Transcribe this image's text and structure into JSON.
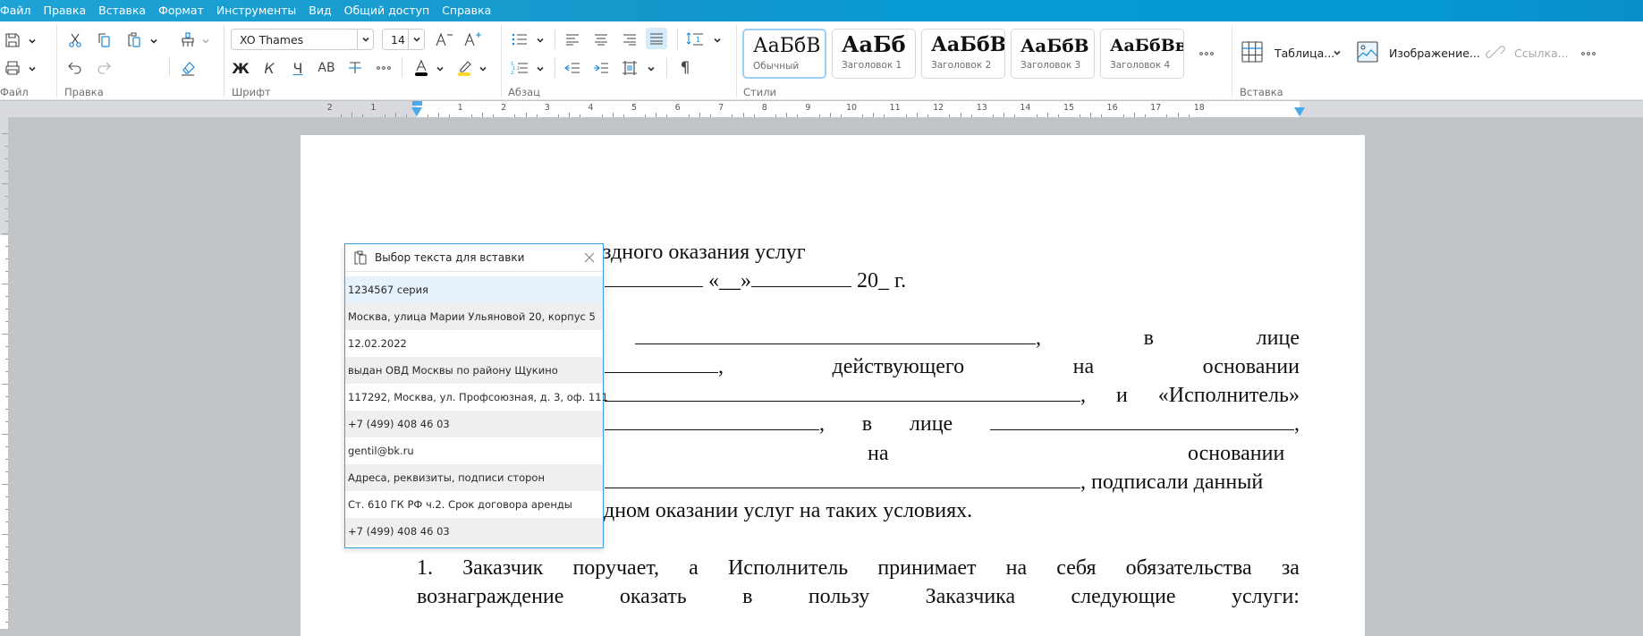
{
  "menu": [
    "Файл",
    "Правка",
    "Вставка",
    "Формат",
    "Инструменты",
    "Вид",
    "Общий доступ",
    "Справка"
  ],
  "ribbon": {
    "groups": {
      "file": "Файл",
      "edit": "Правка",
      "font": "Шрифт",
      "paragraph": "Абзац",
      "styles": "Стили",
      "insert": "Вставка"
    },
    "font_name": "XO Thames",
    "font_size": "14",
    "bold_label": "Ж",
    "italic_label": "К",
    "underline_label": "Ч",
    "case_label": "АВ",
    "font_color": "#000000",
    "highlight_color": "#ffd52e",
    "styles": [
      {
        "sample": "АаБбВ",
        "name": "Обычный",
        "selected": true
      },
      {
        "sample": "АаБб",
        "name": "Заголовок 1"
      },
      {
        "sample": "АаБбВ",
        "name": "Заголовок 2"
      },
      {
        "sample": "АаБбВ",
        "name": "Заголовок 3"
      },
      {
        "sample": "АаБбВв",
        "name": "Заголовок 4"
      }
    ],
    "insert": {
      "table": "Таблица...",
      "image": "Изображение...",
      "link": "Ссылка..."
    }
  },
  "ruler": {
    "left_numbers": [
      "2",
      "1"
    ],
    "right_numbers": [
      "1",
      "2",
      "3",
      "4",
      "5",
      "6",
      "7",
      "8",
      "9",
      "10",
      "11",
      "12",
      "13",
      "14",
      "15",
      "16",
      "17",
      "18"
    ]
  },
  "document": {
    "line1": "здного оказания услуг",
    "line2_quote": "«__»",
    "line2_year": "20_ г.",
    "line3_a": ",",
    "line3_b": "в",
    "line3_c": "лице",
    "line4_a": ",",
    "line4_b": "действующего",
    "line4_c": "на",
    "line4_d": "основании",
    "line5_a": ",",
    "line5_b": "и",
    "line5_c": "«Исполнитель»",
    "line6_a": ",",
    "line6_b": "в",
    "line6_c": "лице",
    "line6_d": ",",
    "line7_a": "на",
    "line7_b": "основании",
    "line8_a": ", подписали данный",
    "line9": "дном оказании услуг на таких условиях.",
    "p1_line1": [
      "1.",
      "Заказчик",
      "поручает,",
      "а",
      "Исполнитель",
      "принимает",
      "на",
      "себя",
      "обязательства",
      "за"
    ],
    "p1_line2": [
      "вознаграждение",
      "оказать",
      "в",
      "пользу",
      "Заказчика",
      "следующие",
      "услуги:"
    ]
  },
  "paste_popup": {
    "title": "Выбор текста для вставки",
    "items": [
      "1234567 серия",
      "Москва, улица Марии Ульяновой 20, корпус 5",
      "12.02.2022",
      "выдан ОВД Москвы по району Щукино",
      "117292, Москва, ул. Профсоюзная, д. 3, оф. 111",
      "+7 (499) 408 46 03",
      "gentil@bk.ru",
      "Адреса, реквизиты, подписи сторон",
      "Ст. 610 ГК РФ ч.2. Срок договора аренды",
      "+7 (499) 408 46 03"
    ]
  },
  "colors": {
    "accent": "#0a9ad5",
    "popup_border": "#3a9ee0",
    "selection_highlight": "#e5f2fb"
  }
}
